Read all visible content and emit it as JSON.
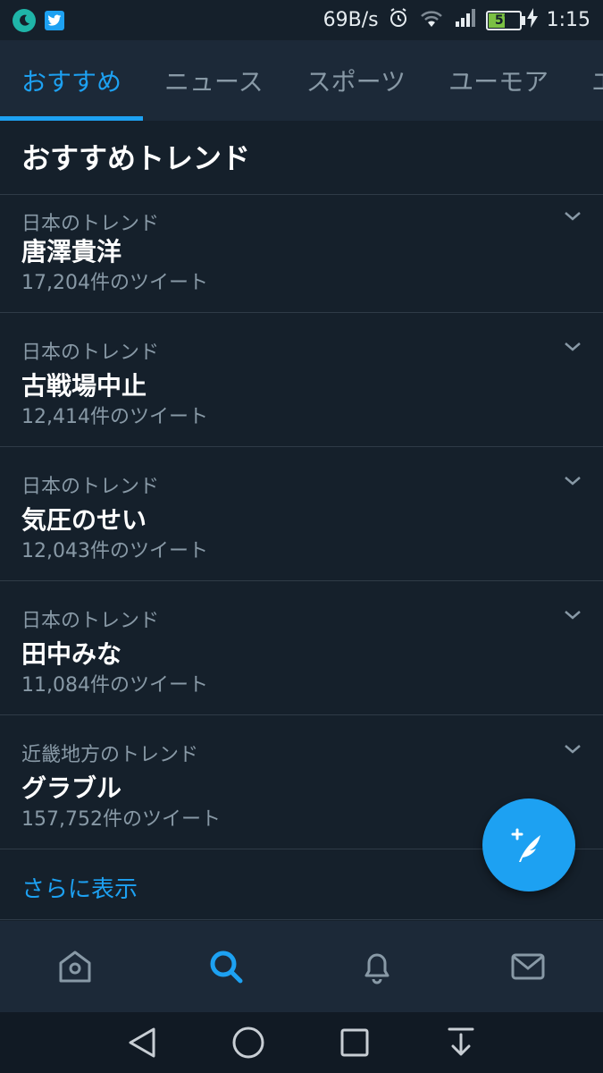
{
  "status_bar": {
    "net_speed": "69B/s",
    "battery_level": "57",
    "time": "1:15"
  },
  "tabs": [
    {
      "label": "おすすめ",
      "active": true
    },
    {
      "label": "ニュース",
      "active": false
    },
    {
      "label": "スポーツ",
      "active": false
    },
    {
      "label": "ユーモア",
      "active": false
    },
    {
      "label": "エ",
      "active": false
    }
  ],
  "section_title": "おすすめトレンド",
  "trends": [
    {
      "context": "日本のトレンド",
      "name": "唐澤貴洋",
      "count": "17,204件のツイート"
    },
    {
      "context": "日本のトレンド",
      "name": "古戦場中止",
      "count": "12,414件のツイート"
    },
    {
      "context": "日本のトレンド",
      "name": "気圧のせい",
      "count": "12,043件のツイート"
    },
    {
      "context": "日本のトレンド",
      "name": "田中みな",
      "count": "11,084件のツイート"
    },
    {
      "context": "近畿地方のトレンド",
      "name": "グラブル",
      "count": "157,752件のツイート"
    }
  ],
  "show_more": "さらに表示",
  "icons": {
    "fab": "compose-tweet-icon",
    "nav": [
      "home-icon",
      "search-icon",
      "notifications-bell-icon",
      "messages-envelope-icon"
    ],
    "system": [
      "back-icon",
      "home-circle-icon",
      "recents-square-icon",
      "notification-pull-icon"
    ]
  },
  "colors": {
    "background": "#15202b",
    "bar": "#1c2938",
    "accent": "#1da1f2",
    "secondary_text": "#8899a6"
  }
}
